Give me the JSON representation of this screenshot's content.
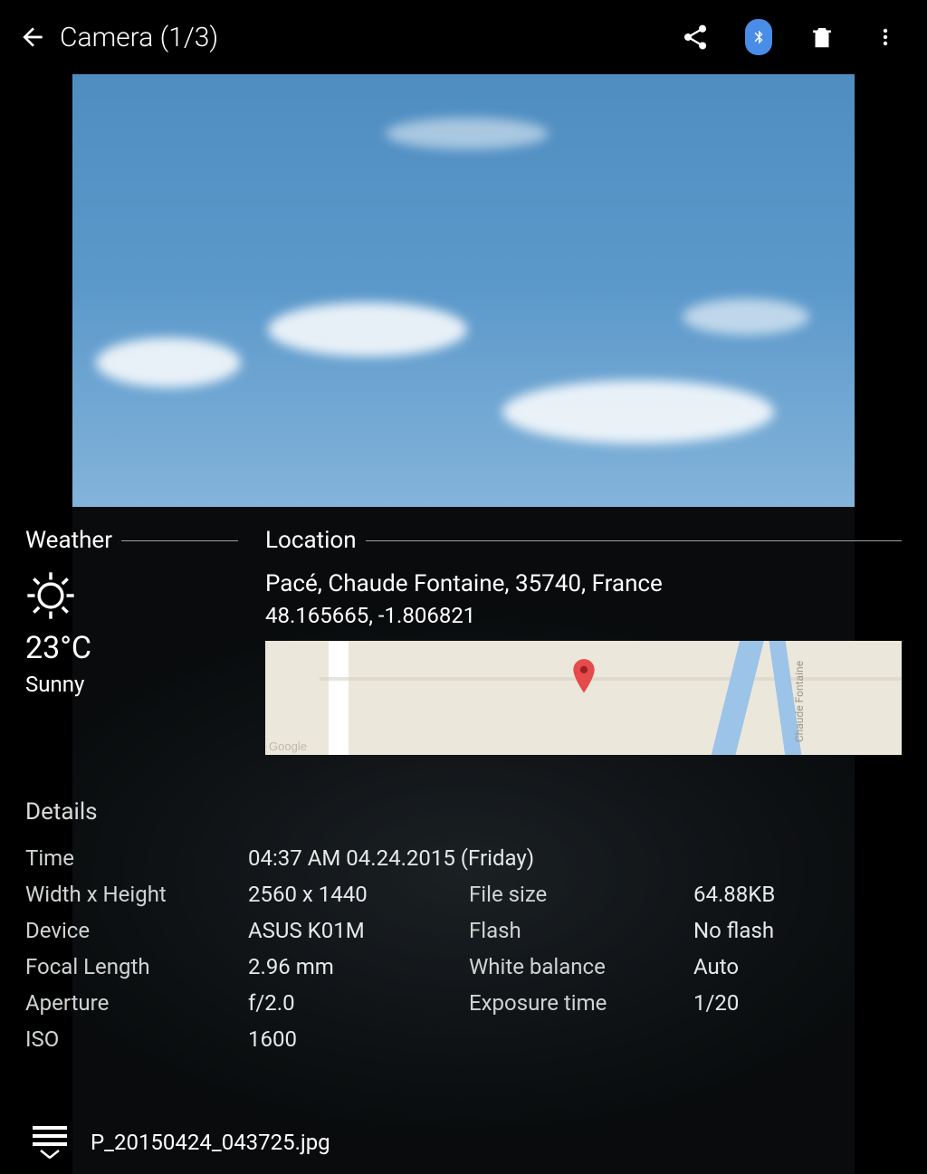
{
  "header": {
    "title": "Camera (1/3)"
  },
  "weather": {
    "section": "Weather",
    "temperature": "23°C",
    "condition": "Sunny"
  },
  "location": {
    "section": "Location",
    "address": "Pacé, Chaude Fontaine, 35740, France",
    "coords": "48.165665, -1.806821",
    "map_street_label": "Chaude Fontaine",
    "map_watermark": "Google"
  },
  "details": {
    "title": "Details",
    "time_label": "Time",
    "time_value": "04:37 AM 04.24.2015 (Friday)",
    "rows": [
      {
        "k": "Width x Height",
        "v": "2560 x 1440",
        "k2": "File size",
        "v2": "64.88KB"
      },
      {
        "k": "Device",
        "v": "ASUS K01M",
        "k2": "Flash",
        "v2": "No flash"
      },
      {
        "k": "Focal Length",
        "v": "2.96 mm",
        "k2": "White balance",
        "v2": "Auto"
      },
      {
        "k": "Aperture",
        "v": "f/2.0",
        "k2": "Exposure time",
        "v2": "1/20"
      },
      {
        "k": "ISO",
        "v": "1600",
        "k2": "",
        "v2": ""
      }
    ]
  },
  "file": {
    "name": "P_20150424_043725.jpg"
  }
}
